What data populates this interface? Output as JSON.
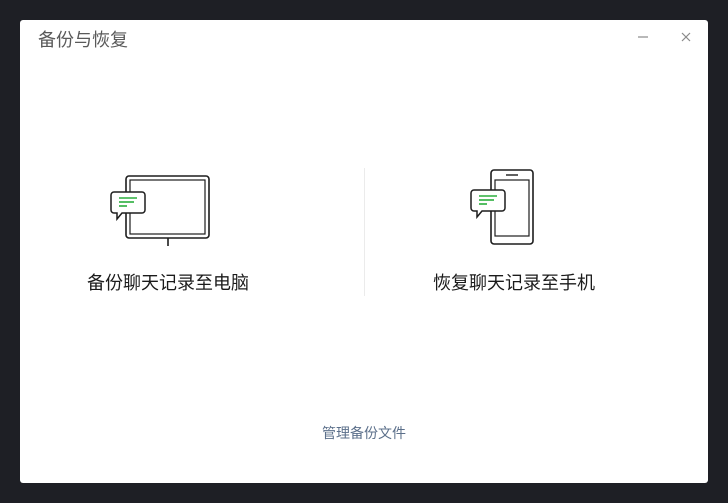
{
  "window": {
    "title": "备份与恢复"
  },
  "controls": {
    "minimize_icon": "minimize-icon",
    "close_icon": "close-icon"
  },
  "options": {
    "backup": {
      "label": "备份聊天记录至电脑",
      "icon": "computer-chat-icon"
    },
    "restore": {
      "label": "恢复聊天记录至手机",
      "icon": "phone-chat-icon"
    }
  },
  "footer": {
    "manage_link": "管理备份文件"
  },
  "colors": {
    "accent_green": "#2bae3d",
    "link": "#5b6f8a",
    "background": "#1e1f25"
  }
}
